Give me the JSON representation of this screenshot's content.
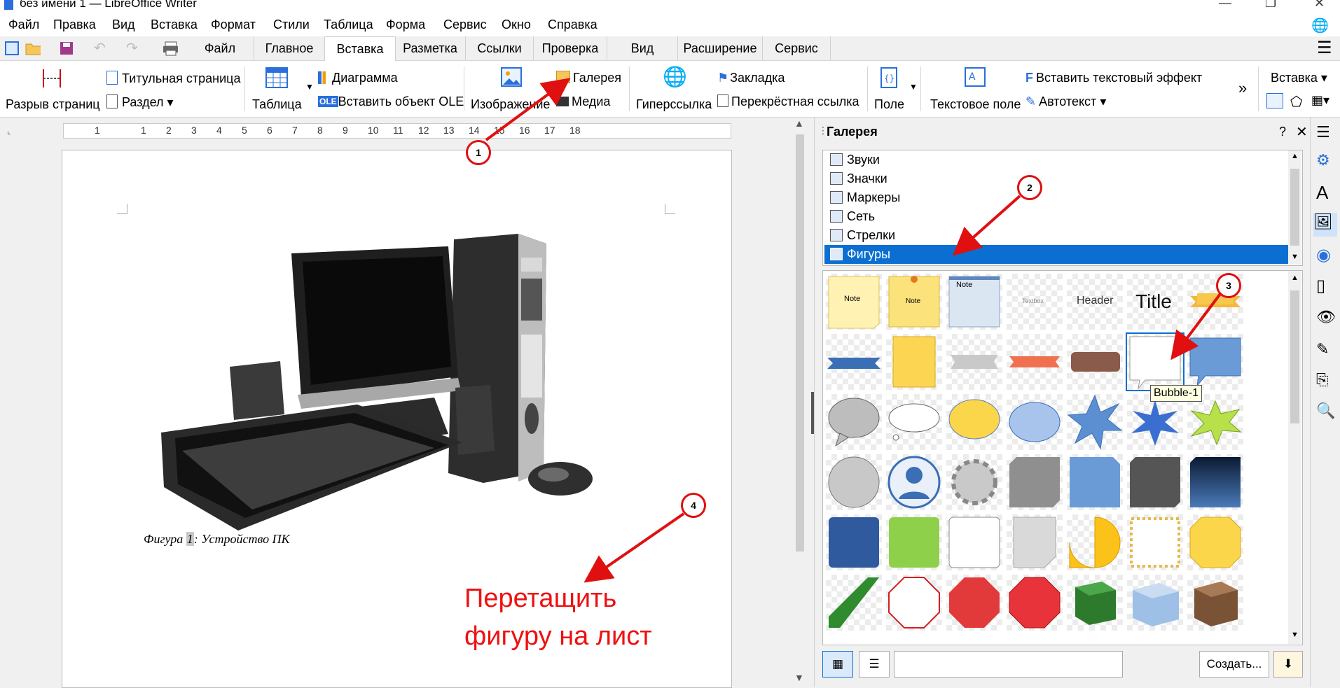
{
  "window": {
    "title": "без имени 1 — LibreOffice Writer"
  },
  "menubar": [
    "Файл",
    "Правка",
    "Вид",
    "Вставка",
    "Формат",
    "Стили",
    "Таблица",
    "Форма",
    "Сервис",
    "Окно",
    "Справка"
  ],
  "tabs": [
    {
      "label": "Файл",
      "active": false
    },
    {
      "label": "Главное",
      "active": false
    },
    {
      "label": "Вставка",
      "active": true
    },
    {
      "label": "Разметка",
      "active": false
    },
    {
      "label": "Ссылки",
      "active": false
    },
    {
      "label": "Проверка",
      "active": false
    },
    {
      "label": "Вид",
      "active": false
    },
    {
      "label": "Расширение",
      "active": false
    },
    {
      "label": "Сервис",
      "active": false
    }
  ],
  "ribbon": {
    "page_break": "Разрыв страниц",
    "title_page": "Титульная страница",
    "section": "Раздел",
    "table": "Таблица",
    "chart": "Диаграмма",
    "ole": "Вставить объект OLE",
    "ole_badge": "OLE",
    "image": "Изображение",
    "gallery": "Галерея",
    "media": "Медиа",
    "hyperlink": "Гиперссылка",
    "bookmark": "Закладка",
    "cross_ref": "Перекрёстная ссылка",
    "field": "Поле",
    "textbox": "Текстовое поле",
    "text_effect": "Вставить текстовый эффект",
    "autotext": "Автотекст",
    "more": "»",
    "insert_dropdown": "Вставка"
  },
  "ruler": [
    "1",
    "1",
    "2",
    "3",
    "4",
    "5",
    "6",
    "7",
    "8",
    "9",
    "10",
    "11",
    "12",
    "13",
    "14",
    "15",
    "16",
    "17",
    "18"
  ],
  "document": {
    "caption_prefix": "Фигура ",
    "caption_number": "1",
    "caption_suffix": ": Устройство ПК",
    "annotation_line1": "Перетащить",
    "annotation_line2": "фигуру на лист"
  },
  "gallery": {
    "title": "Галерея",
    "help": "?",
    "close": "✕",
    "themes": [
      {
        "label": "Звуки",
        "selected": false
      },
      {
        "label": "Значки",
        "selected": false
      },
      {
        "label": "Маркеры",
        "selected": false
      },
      {
        "label": "Сеть",
        "selected": false
      },
      {
        "label": "Стрелки",
        "selected": false
      },
      {
        "label": "Фигуры",
        "selected": true
      }
    ],
    "item_labels": {
      "note": "Note",
      "textbox": "Textbox",
      "header": "Header",
      "title": "Title"
    },
    "tooltip": "Bubble-1",
    "create_button": "Создать..."
  },
  "callouts": [
    "1",
    "2",
    "3",
    "4"
  ],
  "colors": {
    "accent": "#0a6fd1",
    "annotation": "#ee1111"
  }
}
